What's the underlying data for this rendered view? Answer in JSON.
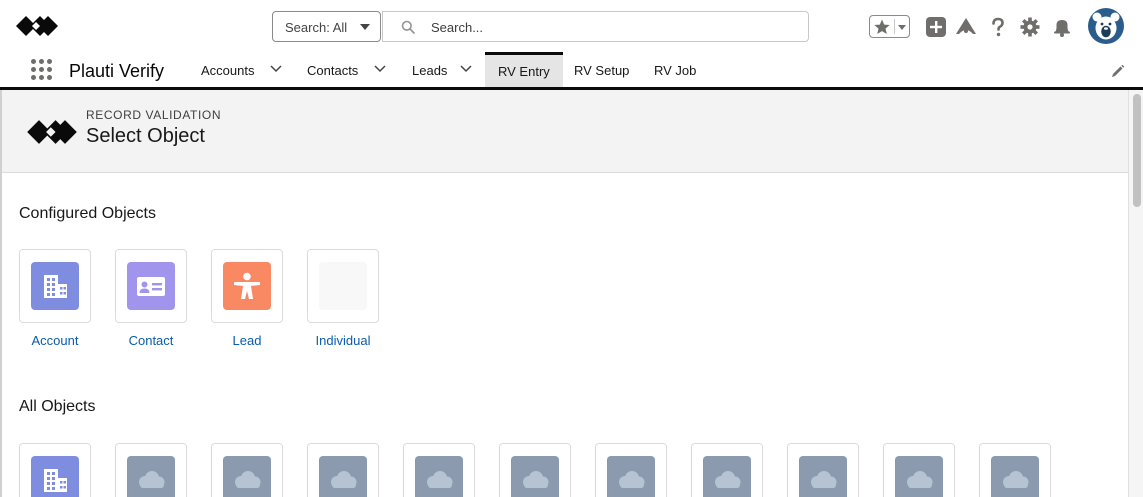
{
  "header": {
    "search_scope": "Search: All",
    "search_placeholder": "Search...",
    "icon_names": [
      "favorites-star-icon",
      "global-actions-add-icon",
      "trailhead-guide-icon",
      "help-icon",
      "setup-gear-icon",
      "notifications-bell-icon",
      "user-avatar-icon"
    ]
  },
  "nav": {
    "app_name": "Plauti Verify",
    "tabs": [
      {
        "label": "Accounts",
        "has_menu": true,
        "active": false
      },
      {
        "label": "Contacts",
        "has_menu": true,
        "active": false
      },
      {
        "label": "Leads",
        "has_menu": true,
        "active": false
      },
      {
        "label": "RV Entry",
        "has_menu": false,
        "active": true
      },
      {
        "label": "RV Setup",
        "has_menu": false,
        "active": false
      },
      {
        "label": "RV Job",
        "has_menu": false,
        "active": false
      }
    ]
  },
  "page_header": {
    "kicker": "RECORD VALIDATION",
    "title": "Select Object"
  },
  "configured": {
    "title": "Configured Objects",
    "items": [
      {
        "label": "Account",
        "icon": "account-building-icon",
        "color": "#7f8de1"
      },
      {
        "label": "Contact",
        "icon": "contact-card-icon",
        "color": "#a094ed"
      },
      {
        "label": "Lead",
        "icon": "lead-person-icon",
        "color": "#f88962"
      },
      {
        "label": "Individual",
        "icon": "blank-icon",
        "color": "#f8f8f8"
      }
    ]
  },
  "all_objects": {
    "title": "All Objects",
    "items": [
      {
        "icon": "account-building-icon",
        "color": "#7f8de1"
      },
      {
        "icon": "cloud-icon",
        "color": "#8b9aae"
      },
      {
        "icon": "cloud-icon",
        "color": "#8b9aae"
      },
      {
        "icon": "cloud-icon",
        "color": "#8b9aae"
      },
      {
        "icon": "cloud-icon",
        "color": "#8b9aae"
      },
      {
        "icon": "cloud-icon",
        "color": "#8b9aae"
      },
      {
        "icon": "cloud-icon",
        "color": "#8b9aae"
      },
      {
        "icon": "cloud-icon",
        "color": "#8b9aae"
      },
      {
        "icon": "cloud-icon",
        "color": "#8b9aae"
      },
      {
        "icon": "cloud-icon",
        "color": "#8b9aae"
      },
      {
        "icon": "cloud-icon",
        "color": "#8b9aae"
      }
    ]
  },
  "colors": {
    "link": "#0b5cab",
    "active_tab_bg": "#e5e5e5",
    "header_bg": "#f3f3f3"
  }
}
